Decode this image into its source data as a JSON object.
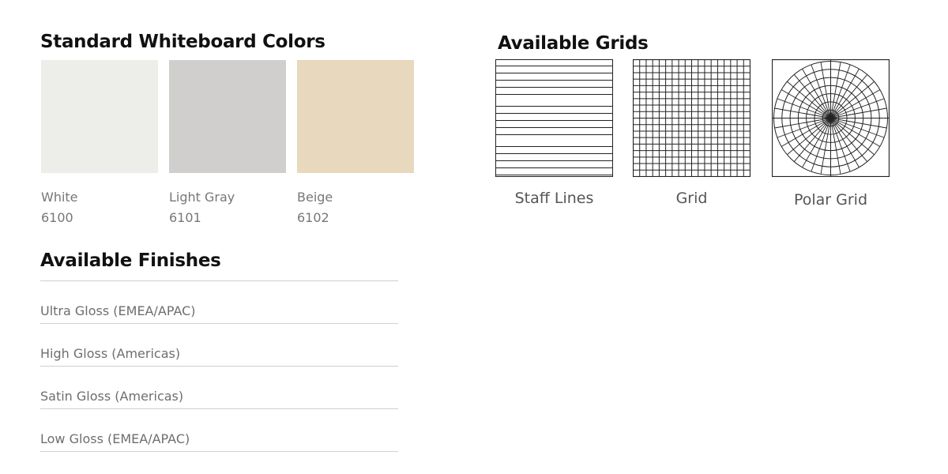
{
  "colors_section": {
    "title": "Standard Whiteboard Colors",
    "swatches": [
      {
        "name": "White",
        "code": "6100",
        "color": "#ededea"
      },
      {
        "name": "Light Gray",
        "code": "6101",
        "color": "#d1cfcd"
      },
      {
        "name": "Beige",
        "code": "6102",
        "color": "#e8d8bd"
      }
    ]
  },
  "finishes_section": {
    "title": "Available Finishes",
    "items": [
      "Ultra Gloss (EMEA/APAC)",
      "High Gloss (Americas)",
      "Satin Gloss (Americas)",
      "Low Gloss (EMEA/APAC)"
    ]
  },
  "grids_section": {
    "title": "Available Grids",
    "items": [
      {
        "label": "Staff Lines",
        "icon": "staff-lines-pattern-icon"
      },
      {
        "label": "Grid",
        "icon": "square-grid-pattern-icon"
      },
      {
        "label": "Polar Grid",
        "icon": "polar-grid-pattern-icon"
      }
    ]
  }
}
